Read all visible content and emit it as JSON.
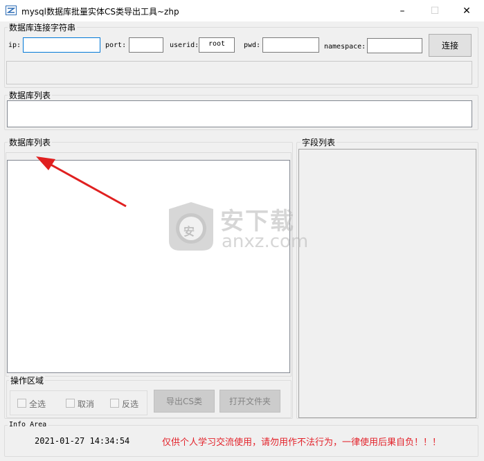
{
  "window": {
    "title": "mysql数据库批量实体CS类导出工具~zhp",
    "minimize_glyph": "–",
    "maximize_glyph": "☐",
    "close_glyph": "✕"
  },
  "connection": {
    "group_label": "数据库连接字符串",
    "ip_label": "ip:",
    "ip_value": "",
    "port_label": "port:",
    "port_value": "",
    "userid_label": "userid:",
    "userid_value": "root",
    "pwd_label": "pwd:",
    "pwd_value": "",
    "namespace_label": "namespace:",
    "namespace_value": "",
    "connect_button": "连接"
  },
  "db_list_top": {
    "group_label": "数据库列表"
  },
  "db_list_left": {
    "group_label": "数据库列表"
  },
  "field_list": {
    "group_label": "字段列表"
  },
  "operations": {
    "group_label": "操作区域",
    "select_all": "全选",
    "cancel": "取消",
    "invert": "反选",
    "export_button": "导出CS类",
    "open_folder_button": "打开文件夹"
  },
  "info": {
    "group_label": "Info Area",
    "timestamp": "2021-01-27 14:34:54",
    "notice": "仅供个人学习交流使用，请勿用作不法行为，一律使用后果自负！！！"
  },
  "watermark": {
    "brand_cn": "安下载",
    "brand_domain": "anxz.com",
    "badge_glyph": "安"
  },
  "colors": {
    "accent_arrow": "#e02020",
    "notice_red": "#e3232b",
    "focus_blue": "#0078d7"
  }
}
